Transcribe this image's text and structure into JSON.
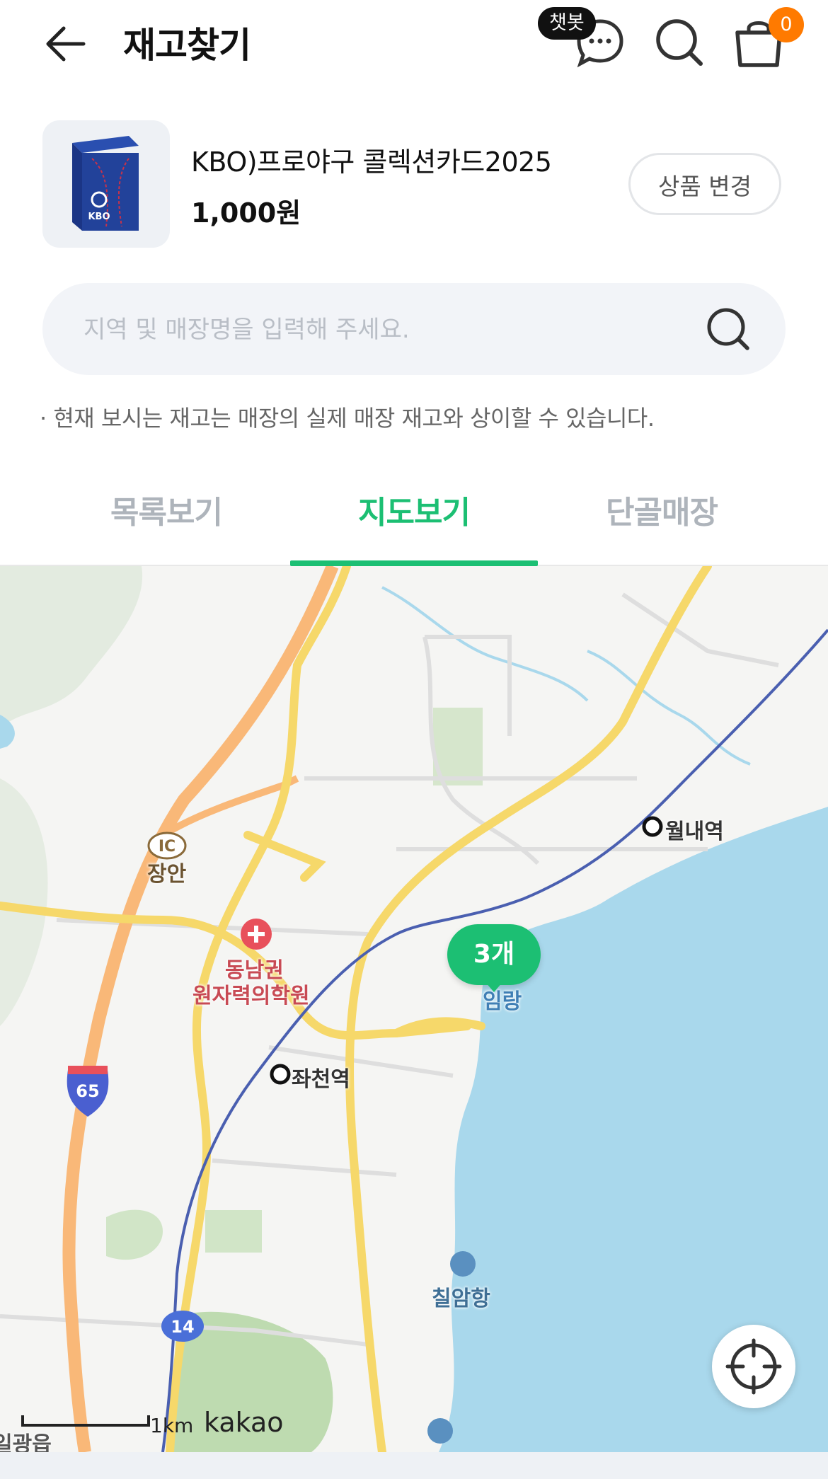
{
  "header": {
    "title": "재고찾기",
    "chatbot_badge": "챗봇",
    "cart_count": "0"
  },
  "product": {
    "name": "KBO)프로야구 콜렉션카드2025",
    "price": "1,000원",
    "change_label": "상품 변경",
    "thumb_text": "KBO"
  },
  "search": {
    "placeholder": "지역 및 매장명을 입력해 주세요."
  },
  "notice": "· 현재 보시는 재고는 매장의 실제 매장 재고와 상이할 수 있습니다.",
  "tabs": [
    {
      "label": "목록보기",
      "active": false
    },
    {
      "label": "지도보기",
      "active": true
    },
    {
      "label": "단골매장",
      "active": false
    }
  ],
  "map": {
    "cluster_label": "3개",
    "labels": {
      "ic": "IC",
      "jangan": "장안",
      "hospital_line1": "동남권",
      "hospital_line2": "원자력의학원",
      "jwacheon": "좌천역",
      "wollae": "월내역",
      "imrang": "임랑",
      "chiram": "칠암항",
      "highway65": "65",
      "route14": "14",
      "bottom_left": "일광읍"
    },
    "scale": "1km",
    "logo": "kakao"
  },
  "colors": {
    "accent": "#1cbf73",
    "cart_badge": "#ff7a00",
    "sea": "#a9d8ec",
    "road_yellow": "#f6d86a",
    "highway_orange": "#f9b878"
  }
}
